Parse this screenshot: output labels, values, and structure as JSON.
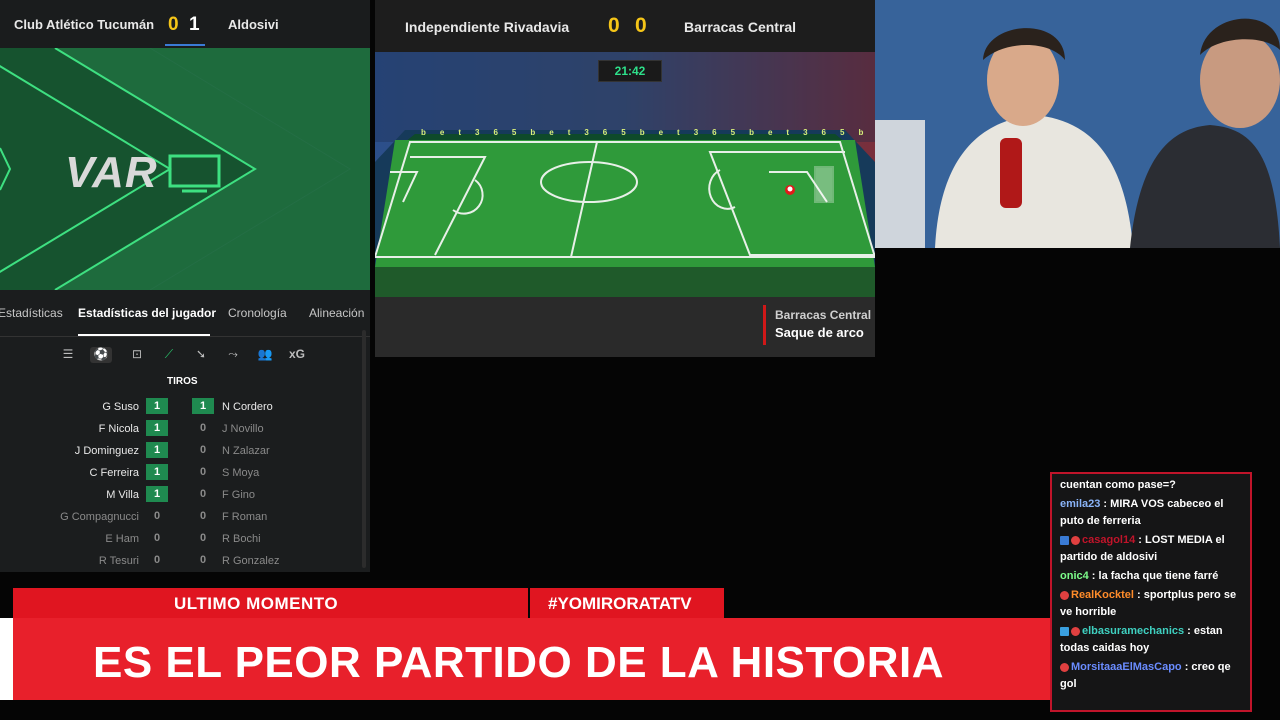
{
  "left_score": {
    "team_a": "Club Atlético Tucumán",
    "score_a": "0",
    "score_b": "1",
    "team_b": "Aldosivi"
  },
  "var_panel": {
    "label": "VAR",
    "icon": "tv-icon"
  },
  "tabs": {
    "t1": "Estadísticas",
    "t2": "Estadísticas del jugador",
    "t3": "Cronología",
    "t4": "Alineación",
    "active": "Estadísticas del jugador"
  },
  "icons": {
    "i1": "list-icon",
    "i2": "shot-icon",
    "i3": "goal-frame-icon",
    "i4": "pass-icon",
    "i5": "dribble-icon",
    "i6": "tackle-icon",
    "i7": "lineup-icon",
    "xg": "xG"
  },
  "section_title": "TIROS",
  "players": [
    {
      "left": "G Suso",
      "lv": "1",
      "rv": "1",
      "right": "N Cordero"
    },
    {
      "left": "F Nicola",
      "lv": "1",
      "rv": "0",
      "right": "J Novillo"
    },
    {
      "left": "J Dominguez",
      "lv": "1",
      "rv": "0",
      "right": "N Zalazar"
    },
    {
      "left": "C Ferreira",
      "lv": "1",
      "rv": "0",
      "right": "S Moya"
    },
    {
      "left": "M Villa",
      "lv": "1",
      "rv": "0",
      "right": "F Gino"
    },
    {
      "left": "G Compagnucci",
      "lv": "0",
      "rv": "0",
      "right": "F Roman"
    },
    {
      "left": "E Ham",
      "lv": "0",
      "rv": "0",
      "right": "R Bochi"
    },
    {
      "left": "R Tesuri",
      "lv": "0",
      "rv": "0",
      "right": "R Gonzalez"
    }
  ],
  "match": {
    "team_a": "Independiente Rivadavia",
    "score_a": "0",
    "score_b": "0",
    "team_b": "Barracas Central",
    "clock": "21:42",
    "sponsor": "bet365"
  },
  "event": {
    "team": "Barracas Central",
    "text": "Saque de arco"
  },
  "banner": {
    "top": "ULTIMO MOMENTO",
    "hashtag": "#YOMIRORATATV",
    "headline": "ES EL PEOR PARTIDO DE LA HISTORIA"
  },
  "chat": [
    {
      "user": "",
      "text": "cuentan como pase=?",
      "color": "#ffffff"
    },
    {
      "user": "emila23",
      "text": " : MIRA VOS cabeceo el puto de ferreria",
      "color": "#8ab4f8"
    },
    {
      "user": "casagol14",
      "text": " : LOST MEDIA el partido de aldosivi",
      "color": "#c0142a"
    },
    {
      "user": "onic4",
      "text": " : la facha que tiene farré",
      "color": "#7cfc8a"
    },
    {
      "user": "RealKocktel",
      "text": " : sportplus pero se ve horrible",
      "color": "#ff8c2a"
    },
    {
      "user": "elbasuramechanics",
      "text": " : estan todas caidas hoy",
      "color": "#3fd0c0"
    },
    {
      "user": "MorsitaaaElMasCapo",
      "text": " : creo qe gol",
      "color": "#6a8cff"
    }
  ]
}
